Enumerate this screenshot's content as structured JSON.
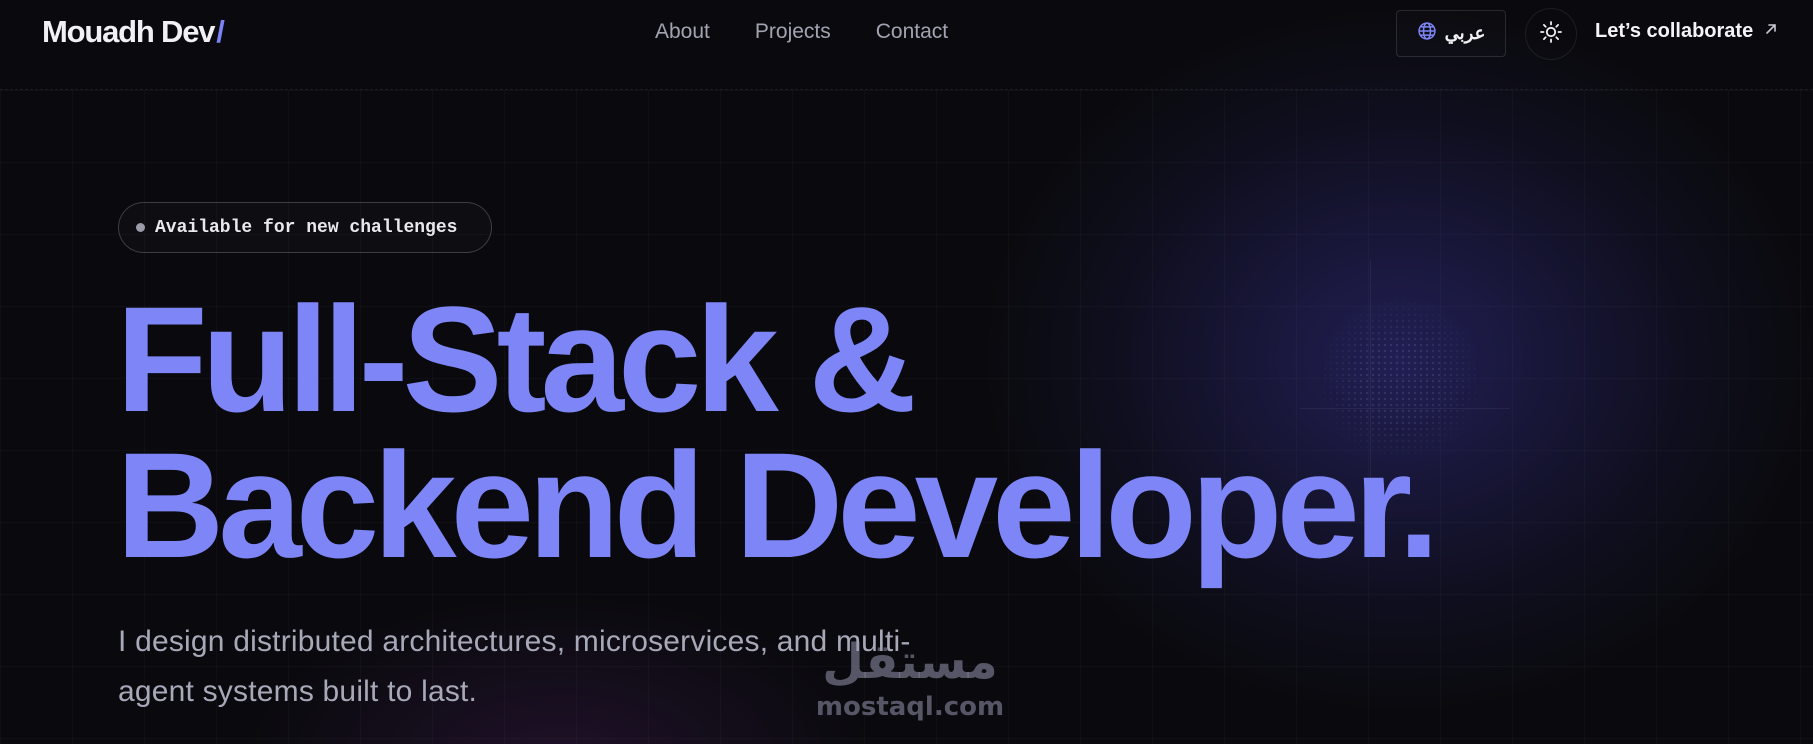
{
  "header": {
    "logo_text": "Mouadh Dev",
    "logo_slash": "/",
    "nav": [
      {
        "label": "About"
      },
      {
        "label": "Projects"
      },
      {
        "label": "Contact"
      }
    ],
    "language_button": {
      "label": "عربي",
      "icon": "globe-icon"
    },
    "theme_toggle": {
      "icon": "sun-icon"
    },
    "cta": {
      "label": "Let’s collaborate",
      "icon": "arrow-up-right-icon"
    }
  },
  "hero": {
    "badge": "Available for new challenges",
    "headline_line1": "Full-Stack &",
    "headline_line2": "Backend Developer.",
    "subtitle_line1": "I design distributed architectures, microservices, and multi-",
    "subtitle_line2": "agent systems built to last."
  },
  "watermark": {
    "arabic": "مستقل",
    "latin": "mostaql.com"
  },
  "colors": {
    "background": "#0a0a0e",
    "accent": "#7e86f7",
    "text": "#f1f1f4",
    "muted": "#a2a3b0"
  }
}
